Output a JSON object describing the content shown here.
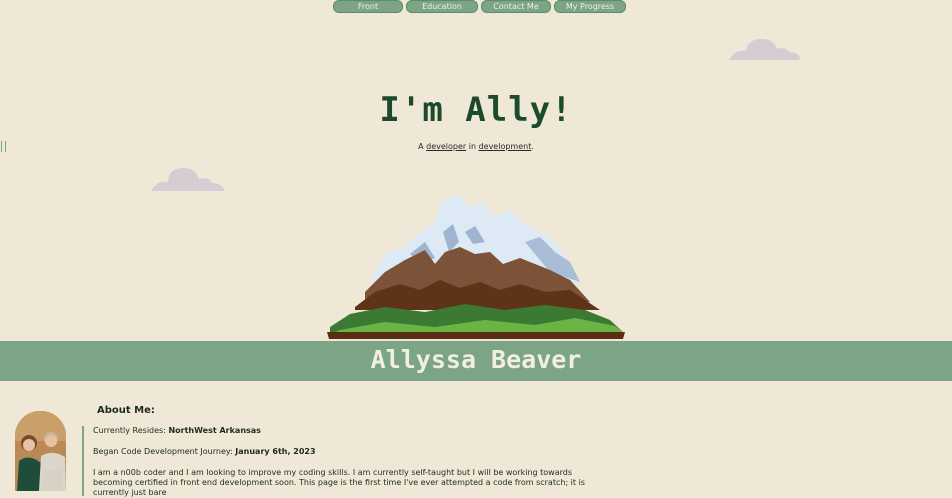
{
  "nav": {
    "tabs": [
      {
        "label": "Front"
      },
      {
        "label": "Education"
      },
      {
        "label": "Contact Me"
      },
      {
        "label": "My Progress"
      }
    ]
  },
  "hero": {
    "title": "I'm Ally!",
    "tagline_prefix": "A ",
    "tagline_word1": "developer",
    "tagline_mid": " in ",
    "tagline_word2": "development",
    "tagline_suffix": "."
  },
  "banner": {
    "name": "Allyssa Beaver"
  },
  "about": {
    "heading": "About Me:",
    "resides_label": "Currently Resides: ",
    "resides_value": "NorthWest Arkansas",
    "began_label": "Began Code Development Journey: ",
    "began_value": "January 6th, 2023",
    "paragraph": "I am a n00b coder and I am looking to improve my coding skills. I am currently self-taught but I will be working towards becoming certified in front end development soon. This page is the first time I've ever attempted a code from scratch; it is currently just bare"
  },
  "colors": {
    "background": "#efe8d6",
    "accent_green": "#7ba584",
    "title_green": "#1d4a2a",
    "cloud": "#d8ccd3"
  },
  "icons": [
    "cloud-icon",
    "mountain-illustration",
    "profile-photo"
  ]
}
